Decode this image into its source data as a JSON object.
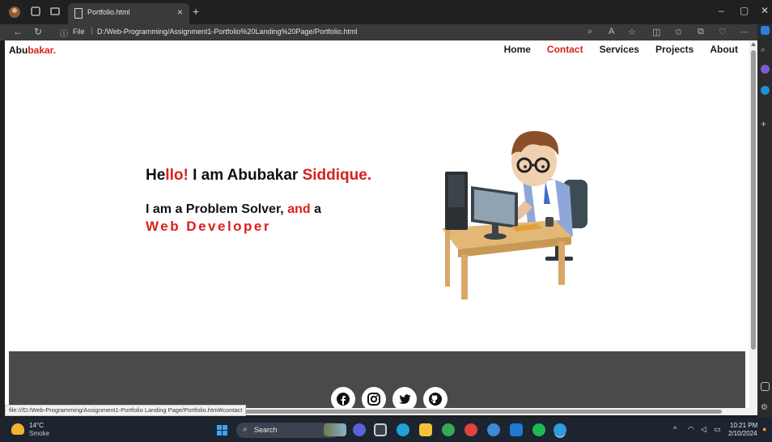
{
  "browser": {
    "tab_title": "Portfolio.html",
    "tab_close": "×",
    "new_tab": "+",
    "address": {
      "file_label": "File",
      "url": "D:/Web-Programming/Assignment1-Portfolio%20Landing%20Page/Portfolio.html"
    },
    "status_url": "file:///D:/Web-Programming/Assignment1-Portfolio Landing Page/Portfolio.html#contact"
  },
  "site": {
    "brand_main": "Abu",
    "brand_accent": "bakar.",
    "nav": [
      "Home",
      "Contact",
      "Services",
      "Projects",
      "About"
    ],
    "active_nav": "Contact",
    "hero": {
      "hello_prefix": "He",
      "hello_accent": "llo!",
      "intro": " I am Abubakar ",
      "name_accent": "Siddique.",
      "line2_main": "I am a Problem Solver, ",
      "line2_accent": "and",
      "line2_end": " a",
      "role": "Web Developer"
    },
    "socials": [
      "facebook-icon",
      "instagram-icon",
      "twitter-icon",
      "github-icon"
    ]
  },
  "taskbar": {
    "temperature": "14°C",
    "weather": "Smoke",
    "search_placeholder": "Search",
    "time": "10:21 PM",
    "date": "2/10/2024"
  },
  "colors": {
    "accent": "#d9201c",
    "footer": "#4a4a4a",
    "taskbar": "#1c2430"
  }
}
